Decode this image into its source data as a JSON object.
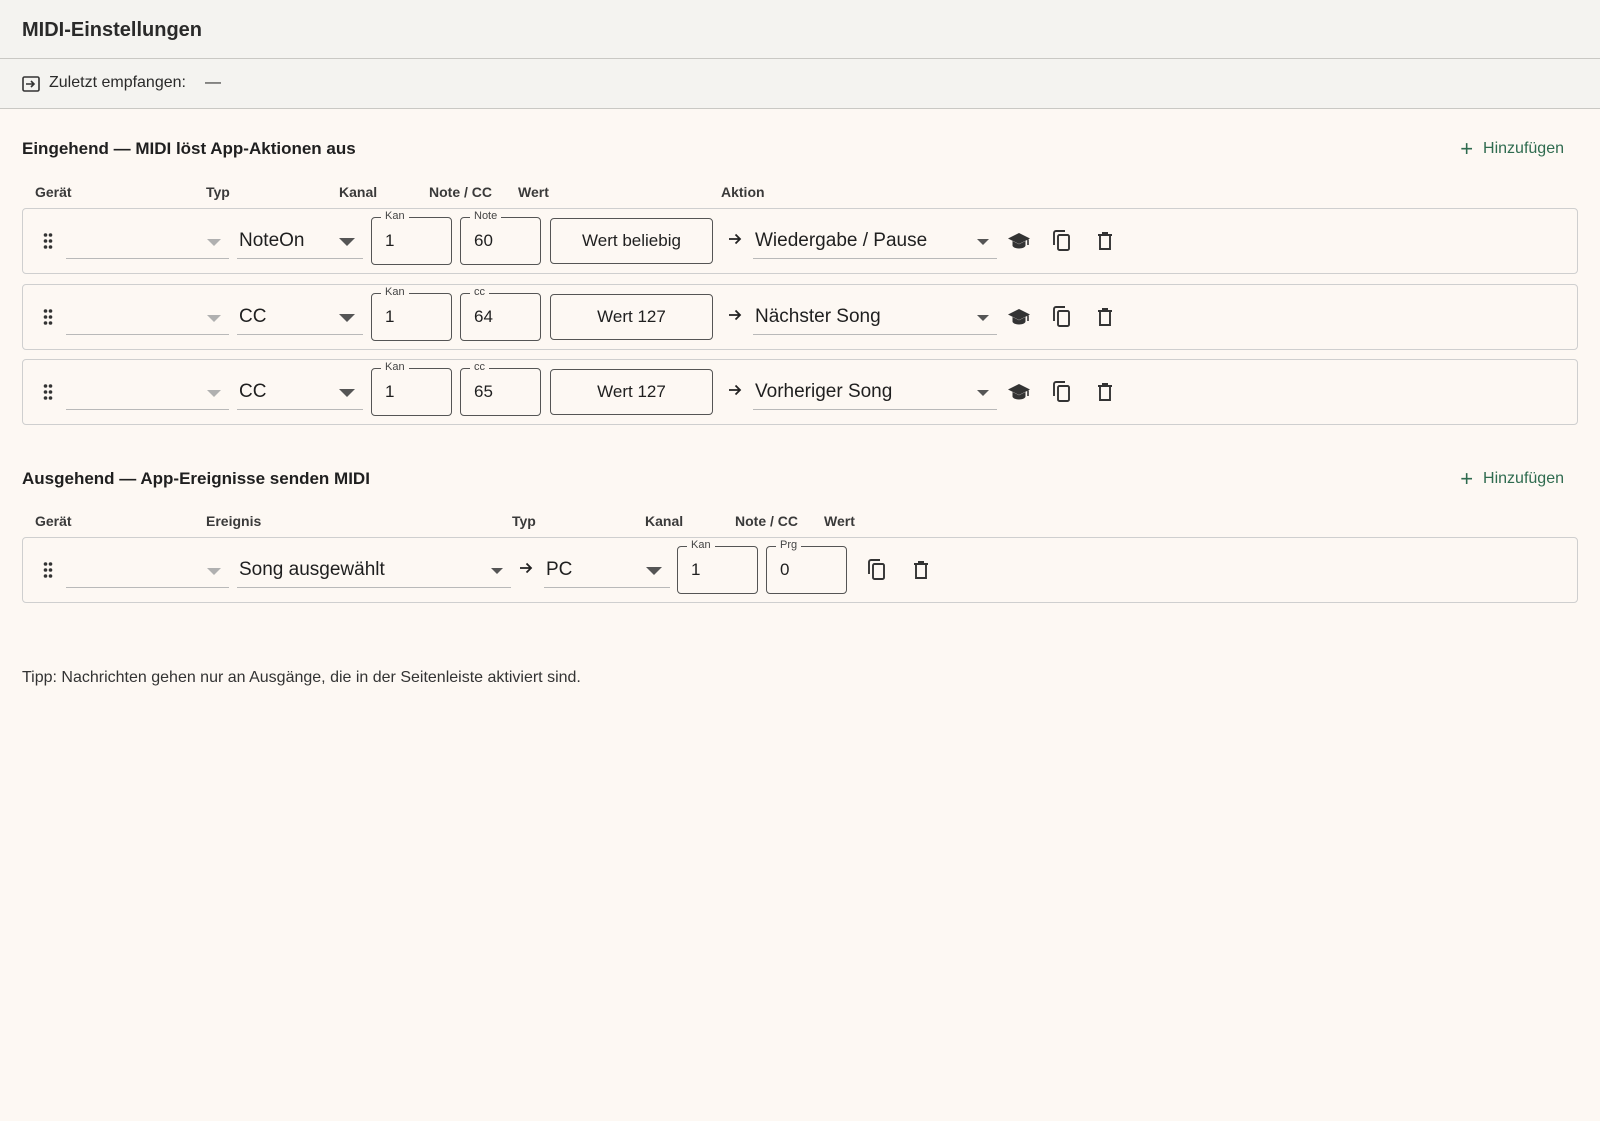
{
  "header": {
    "title": "MIDI-Einstellungen"
  },
  "status": {
    "label": "Zuletzt empfangen:",
    "value": "—",
    "icon": "input-icon"
  },
  "incoming": {
    "title": "Eingehend — MIDI löst App-Aktionen aus",
    "add_label": "Hinzufügen",
    "columns": {
      "device": "Gerät",
      "type": "Typ",
      "channel": "Kanal",
      "note_cc": "Note / CC",
      "value": "Wert",
      "action": "Aktion"
    },
    "rows": [
      {
        "device": "",
        "type": "NoteOn",
        "ch_label": "Kan",
        "channel": "1",
        "num_label": "Note",
        "number": "60",
        "value": "Wert beliebig",
        "action": "Wiedergabe / Pause"
      },
      {
        "device": "",
        "type": "CC",
        "ch_label": "Kan",
        "channel": "1",
        "num_label": "cc",
        "number": "64",
        "value": "Wert 127",
        "action": "Nächster Song"
      },
      {
        "device": "",
        "type": "CC",
        "ch_label": "Kan",
        "channel": "1",
        "num_label": "cc",
        "number": "65",
        "value": "Wert 127",
        "action": "Vorheriger Song"
      }
    ]
  },
  "outgoing": {
    "title": "Ausgehend — App-Ereignisse senden MIDI",
    "add_label": "Hinzufügen",
    "columns": {
      "device": "Gerät",
      "event": "Ereignis",
      "type": "Typ",
      "channel": "Kanal",
      "note_cc": "Note / CC",
      "value": "Wert"
    },
    "rows": [
      {
        "device": "",
        "event": "Song ausgewählt",
        "type": "PC",
        "ch_label": "Kan",
        "channel": "1",
        "num_label": "Prg",
        "number": "0"
      }
    ]
  },
  "tip": "Tipp: Nachrichten gehen nur an Ausgänge, die in der Seitenleiste aktiviert sind.",
  "colors": {
    "accent": "#2f6b4f",
    "background": "#fdf8f3",
    "header": "#f4f3f0"
  }
}
